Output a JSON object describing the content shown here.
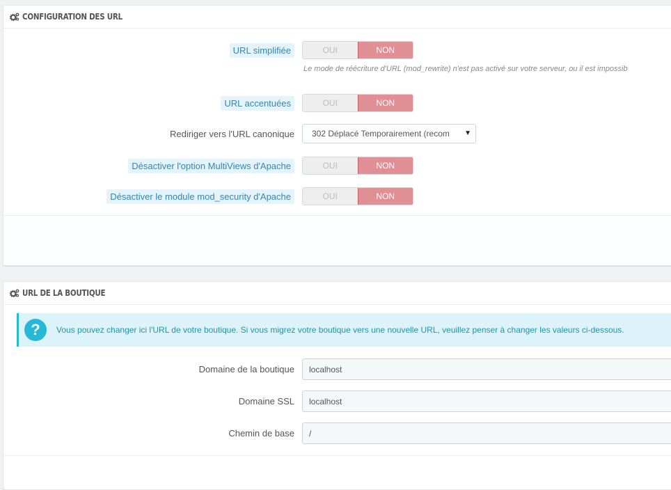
{
  "section1": {
    "title": "CONFIGURATION DES URL",
    "url_simplifiee": {
      "label": "URL simplifiée",
      "yes": "OUI",
      "no": "NON",
      "help": "Le mode de réécriture d'URL (mod_rewrite) n'est pas activé sur votre serveur, ou il est impossib"
    },
    "url_accentuees": {
      "label": "URL accentuées",
      "yes": "OUI",
      "no": "NON"
    },
    "canonique": {
      "label": "Rediriger vers l'URL canonique",
      "value": "302 Déplacé Temporairement (recom"
    },
    "multiviews": {
      "label": "Désactiver l'option MultiViews d'Apache",
      "yes": "OUI",
      "no": "NON"
    },
    "mod_security": {
      "label": "Désactiver le module mod_security d'Apache",
      "yes": "OUI",
      "no": "NON"
    }
  },
  "section2": {
    "title": "URL DE LA BOUTIQUE",
    "alert": "Vous pouvez changer ici l'URL de votre boutique. Si vous migrez votre boutique vers une nouvelle URL, veuillez penser à changer les valeurs ci-dessous.",
    "domaine": {
      "label": "Domaine de la boutique",
      "value": "localhost"
    },
    "domaine_ssl": {
      "label": "Domaine SSL",
      "value": "localhost"
    },
    "chemin": {
      "label": "Chemin de base",
      "value": "/"
    }
  },
  "colors": {
    "switch_no": "#e08f95",
    "hint_bg": "#e5f3fb",
    "hint_text": "#3586ae",
    "alert_bg": "#dcf4f9",
    "alert_accent": "#25b9d7"
  },
  "icons": {
    "heading": "cogs-icon",
    "alert": "question-circle-icon",
    "select": "caret-down-icon"
  }
}
